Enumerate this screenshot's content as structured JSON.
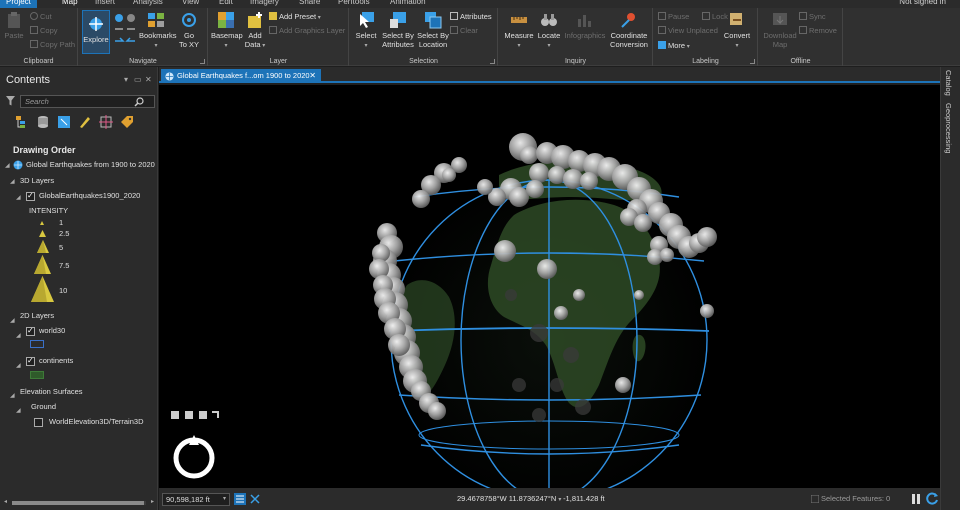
{
  "ribbon_tabs": [
    {
      "label": "Project"
    },
    {
      "label": "Map"
    },
    {
      "label": "Insert"
    },
    {
      "label": "Analysis"
    },
    {
      "label": "View"
    },
    {
      "label": "Edit"
    },
    {
      "label": "Imagery"
    },
    {
      "label": "Share"
    },
    {
      "label": "Perftools"
    },
    {
      "label": "Animation"
    }
  ],
  "sign_in": "Not signed in",
  "ribbon": {
    "clipboard": {
      "label": "Clipboard",
      "paste": "Paste",
      "cut": "Cut",
      "copy": "Copy",
      "copy_path": "Copy Path"
    },
    "navigate": {
      "label": "Navigate",
      "explore": "Explore",
      "bookmarks": "Bookmarks",
      "go_to_xy_1": "Go",
      "go_to_xy_2": "To XY"
    },
    "layer": {
      "label": "Layer",
      "basemap": "Basemap",
      "add_data_1": "Add",
      "add_data_2": "Data",
      "add_preset": "Add Preset",
      "add_graphics_layer": "Add Graphics Layer"
    },
    "selection": {
      "label": "Selection",
      "select": "Select",
      "select_by_attributes_1": "Select By",
      "select_by_attributes_2": "Attributes",
      "select_by_location_1": "Select By",
      "select_by_location_2": "Location",
      "attributes": "Attributes",
      "clear": "Clear"
    },
    "inquiry": {
      "label": "Inquiry",
      "measure": "Measure",
      "locate": "Locate",
      "infographics": "Infographics",
      "coordinate_conversion_1": "Coordinate",
      "coordinate_conversion_2": "Conversion"
    },
    "labeling": {
      "label": "Labeling",
      "pause": "Pause",
      "lock": "Lock",
      "view_unplaced": "View Unplaced",
      "more": "More",
      "convert": "Convert"
    },
    "offline": {
      "label": "Offline",
      "download_map_1": "Download",
      "download_map_2": "Map",
      "sync": "Sync",
      "remove": "Remove"
    }
  },
  "contents": {
    "title": "Contents",
    "search_placeholder": "Search",
    "drawing_order": "Drawing Order",
    "map_name": "Global Earthquakes from 1900 to 2020",
    "group_3d": "3D Layers",
    "layer_quakes": "GlobalEarthquakes1900_2020",
    "legend_field": "INTENSITY",
    "legend_classes": [
      "1",
      "2.5",
      "5",
      "7.5",
      "10"
    ],
    "group_2d": "2D Layers",
    "layer_world30": "world30",
    "layer_continents": "continents",
    "group_elevation": "Elevation Surfaces",
    "ground": "Ground",
    "terrain": "WorldElevation3D/Terrain3D"
  },
  "map_view": {
    "tab_title": "Global Earthquakes f...om 1900 to 2020"
  },
  "status": {
    "scale": "90,598,182 ft",
    "coordinates": "29.4678758°W 11.8736247°N",
    "elevation": "-1,811.428 ft",
    "selected_features": "Selected Features: 0"
  },
  "right_dock": {
    "catalog": "Catalog",
    "geoprocessing": "Geoprocessing"
  },
  "colors": {
    "accent": "#1d73b8",
    "graticule": "#2f8fe0",
    "land": "#2e4a26",
    "legend_symbol": "#d8c840",
    "continents_swatch": "#2f5a2a"
  }
}
